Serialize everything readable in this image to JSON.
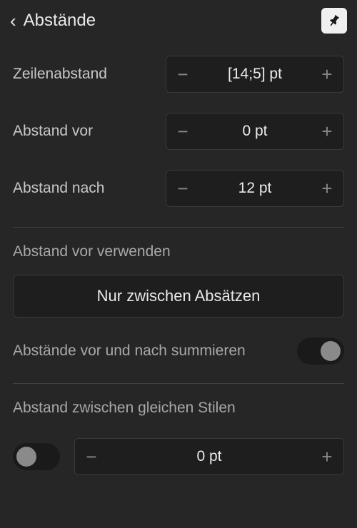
{
  "header": {
    "title": "Abstände"
  },
  "lineSpacing": {
    "label": "Zeilenabstand",
    "value": "[14;5] pt"
  },
  "spaceBefore": {
    "label": "Abstand vor",
    "value": "0 pt"
  },
  "spaceAfter": {
    "label": "Abstand nach",
    "value": "12 pt"
  },
  "useSpaceBefore": {
    "label": "Abstand vor verwenden",
    "selected": "Nur zwischen Absätzen"
  },
  "sumSpaces": {
    "label": "Abstände vor und nach summieren"
  },
  "sameStyles": {
    "label": "Abstand zwischen gleichen Stilen",
    "value": "0 pt"
  }
}
